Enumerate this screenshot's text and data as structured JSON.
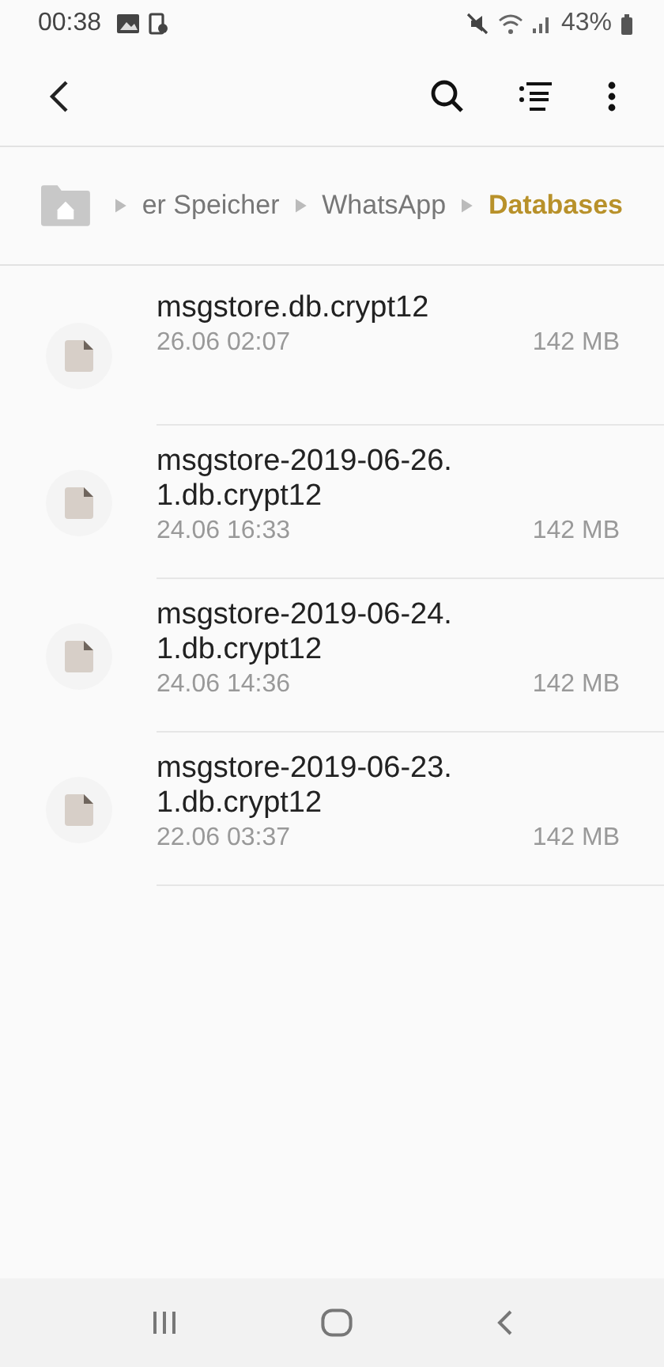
{
  "status_bar": {
    "time": "00:38",
    "battery": "43%"
  },
  "breadcrumb": [
    {
      "label": "er Speicher",
      "selected": false
    },
    {
      "label": "WhatsApp",
      "selected": false
    },
    {
      "label": "Databases",
      "selected": true
    }
  ],
  "files": [
    {
      "name": "msgstore.db.crypt12",
      "date": "26.06 02:07",
      "size": "142 MB"
    },
    {
      "name": "msgstore-2019-06-26.1.db.crypt12",
      "date": "24.06 16:33",
      "size": "142 MB"
    },
    {
      "name": "msgstore-2019-06-24.1.db.crypt12",
      "date": "24.06 14:36",
      "size": "142 MB"
    },
    {
      "name": "msgstore-2019-06-23.1.db.crypt12",
      "date": "22.06 03:37",
      "size": "142 MB"
    }
  ]
}
